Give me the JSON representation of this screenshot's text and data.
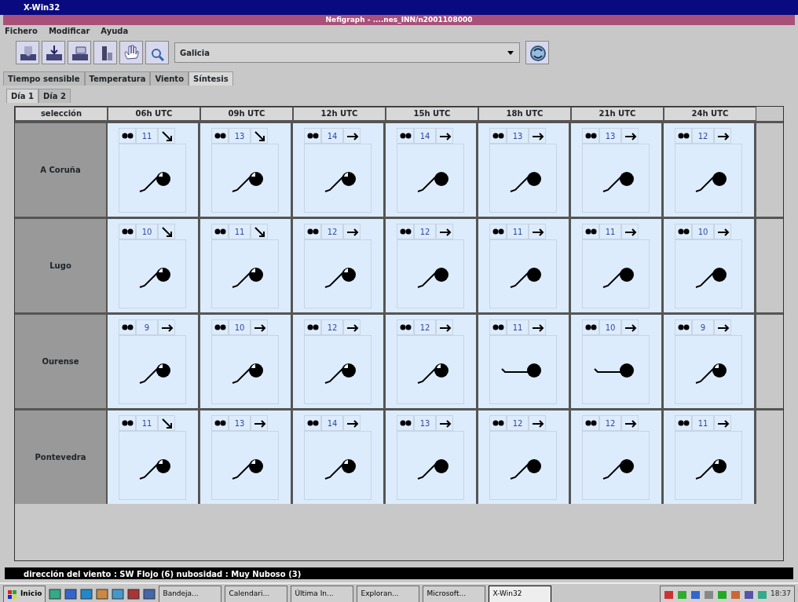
{
  "window": {
    "title": "X-Win32"
  },
  "app": {
    "title": "Nefigraph - ....nes_INN/n2001108000"
  },
  "menu": [
    "Fichero",
    "Modificar",
    "Ayuda"
  ],
  "toolbar": {
    "region": "Galicia"
  },
  "tabs": [
    {
      "label": "Tiempo sensible",
      "selected": false
    },
    {
      "label": "Temperatura",
      "selected": false
    },
    {
      "label": "Viento",
      "selected": false
    },
    {
      "label": "Síntesis",
      "selected": true
    }
  ],
  "days": [
    {
      "label": "Día 1",
      "selected": true
    },
    {
      "label": "Día 2",
      "selected": false
    }
  ],
  "table": {
    "corner": "selección",
    "columns": [
      "06h UTC",
      "09h UTC",
      "12h UTC",
      "15h UTC",
      "18h UTC",
      "21h UTC",
      "24h UTC"
    ],
    "rows": [
      {
        "name": "A Coruña",
        "cells": [
          {
            "temp": "11",
            "arrow": {
              "kind": "se"
            },
            "station": {
              "kind": "partial"
            },
            "stem": {
              "kind": "slanted"
            }
          },
          {
            "temp": "13",
            "arrow": {
              "kind": "se"
            },
            "station": {
              "kind": "partial"
            },
            "stem": {
              "kind": "slanted"
            }
          },
          {
            "temp": "14",
            "arrow": {
              "kind": "e"
            },
            "station": {
              "kind": "partial"
            },
            "stem": {
              "kind": "slanted"
            }
          },
          {
            "temp": "14",
            "arrow": {
              "kind": "e"
            },
            "station": {
              "kind": "full"
            },
            "stem": {
              "kind": "slanted"
            }
          },
          {
            "temp": "13",
            "arrow": {
              "kind": "e"
            },
            "station": {
              "kind": "full"
            },
            "stem": {
              "kind": "slanted"
            }
          },
          {
            "temp": "13",
            "arrow": {
              "kind": "e"
            },
            "station": {
              "kind": "full"
            },
            "stem": {
              "kind": "slanted"
            }
          },
          {
            "temp": "12",
            "arrow": {
              "kind": "e"
            },
            "station": {
              "kind": "full"
            },
            "stem": {
              "kind": "slanted"
            }
          }
        ]
      },
      {
        "name": "Lugo",
        "cells": [
          {
            "temp": "10",
            "arrow": {
              "kind": "se"
            },
            "station": {
              "kind": "partial"
            },
            "stem": {
              "kind": "slanted"
            }
          },
          {
            "temp": "11",
            "arrow": {
              "kind": "se"
            },
            "station": {
              "kind": "partial"
            },
            "stem": {
              "kind": "slanted"
            }
          },
          {
            "temp": "12",
            "arrow": {
              "kind": "e"
            },
            "station": {
              "kind": "partial"
            },
            "stem": {
              "kind": "slanted"
            }
          },
          {
            "temp": "12",
            "arrow": {
              "kind": "e"
            },
            "station": {
              "kind": "full"
            },
            "stem": {
              "kind": "slanted"
            }
          },
          {
            "temp": "11",
            "arrow": {
              "kind": "e"
            },
            "station": {
              "kind": "full"
            },
            "stem": {
              "kind": "slanted"
            }
          },
          {
            "temp": "11",
            "arrow": {
              "kind": "e"
            },
            "station": {
              "kind": "full"
            },
            "stem": {
              "kind": "slanted"
            }
          },
          {
            "temp": "10",
            "arrow": {
              "kind": "e"
            },
            "station": {
              "kind": "full"
            },
            "stem": {
              "kind": "slanted"
            }
          }
        ]
      },
      {
        "name": "Ourense",
        "cells": [
          {
            "temp": "9",
            "arrow": {
              "kind": "e"
            },
            "station": {
              "kind": "partial"
            },
            "stem": {
              "kind": "slanted"
            }
          },
          {
            "temp": "10",
            "arrow": {
              "kind": "e"
            },
            "station": {
              "kind": "partial"
            },
            "stem": {
              "kind": "slanted"
            }
          },
          {
            "temp": "12",
            "arrow": {
              "kind": "e"
            },
            "station": {
              "kind": "partial"
            },
            "stem": {
              "kind": "slanted"
            }
          },
          {
            "temp": "12",
            "arrow": {
              "kind": "e"
            },
            "station": {
              "kind": "partial"
            },
            "stem": {
              "kind": "slanted"
            }
          },
          {
            "temp": "11",
            "arrow": {
              "kind": "e"
            },
            "station": {
              "kind": "full"
            },
            "stem": {
              "kind": "level"
            }
          },
          {
            "temp": "10",
            "arrow": {
              "kind": "e"
            },
            "station": {
              "kind": "full"
            },
            "stem": {
              "kind": "level"
            }
          },
          {
            "temp": "9",
            "arrow": {
              "kind": "e"
            },
            "station": {
              "kind": "partial"
            },
            "stem": {
              "kind": "slanted"
            }
          }
        ]
      },
      {
        "name": "Pontevedra",
        "cells": [
          {
            "temp": "11",
            "arrow": {
              "kind": "se"
            },
            "station": {
              "kind": "partial"
            },
            "stem": {
              "kind": "slanted"
            }
          },
          {
            "temp": "13",
            "arrow": {
              "kind": "e"
            },
            "station": {
              "kind": "partial"
            },
            "stem": {
              "kind": "slanted"
            }
          },
          {
            "temp": "14",
            "arrow": {
              "kind": "e"
            },
            "station": {
              "kind": "partial"
            },
            "stem": {
              "kind": "slanted"
            }
          },
          {
            "temp": "13",
            "arrow": {
              "kind": "e"
            },
            "station": {
              "kind": "full"
            },
            "stem": {
              "kind": "slanted"
            }
          },
          {
            "temp": "12",
            "arrow": {
              "kind": "e"
            },
            "station": {
              "kind": "full"
            },
            "stem": {
              "kind": "slanted"
            }
          },
          {
            "temp": "12",
            "arrow": {
              "kind": "e"
            },
            "station": {
              "kind": "full"
            },
            "stem": {
              "kind": "slanted"
            }
          },
          {
            "temp": "11",
            "arrow": {
              "kind": "e"
            },
            "station": {
              "kind": "partial"
            },
            "stem": {
              "kind": "slanted"
            }
          }
        ]
      }
    ]
  },
  "status_bar": "dirección del viento : SW Flojo (6) nubosidad : Muy Nuboso (3)",
  "taskbar": {
    "start": "Inicio",
    "tasks": [
      {
        "label": "Bandeja...",
        "selected": false
      },
      {
        "label": "Calendari...",
        "selected": false
      },
      {
        "label": "Última In...",
        "selected": false
      },
      {
        "label": "Exploran...",
        "selected": false
      },
      {
        "label": "Microsoft...",
        "selected": false
      },
      {
        "label": "X-Win32",
        "selected": true
      }
    ],
    "clock": "18:37"
  }
}
